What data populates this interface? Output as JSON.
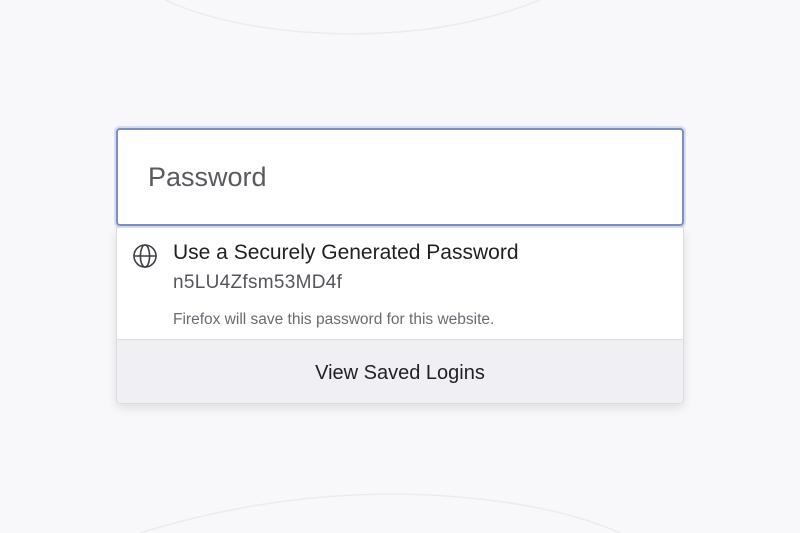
{
  "password_field": {
    "placeholder": "Password",
    "value": ""
  },
  "autocomplete_popup": {
    "suggestion": {
      "icon": "globe-icon",
      "title": "Use a Securely Generated Password",
      "password": "n5LU4Zfsm53MD4f",
      "note": "Firefox will save this password for this website."
    },
    "footer": {
      "label": "View Saved Logins"
    }
  },
  "colors": {
    "page_background": "#f8f8fa",
    "field_focus_border": "#7e8fbf",
    "footer_background": "#f0f0f4"
  }
}
